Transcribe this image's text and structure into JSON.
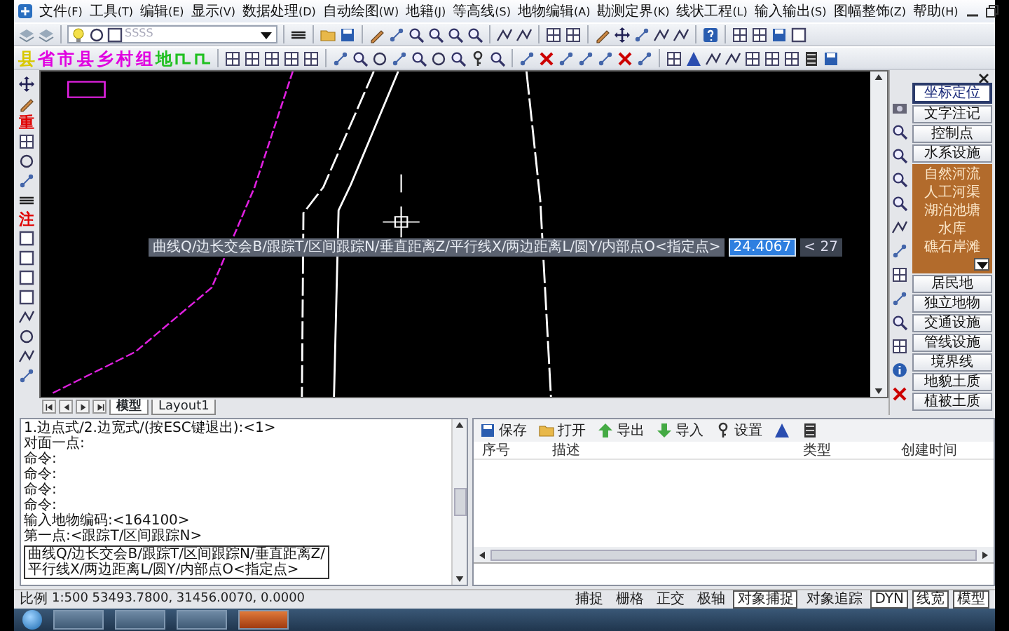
{
  "menu": [
    {
      "label": "文件",
      "key": "(F)"
    },
    {
      "label": "工具",
      "key": "(T)"
    },
    {
      "label": "编辑",
      "key": "(E)"
    },
    {
      "label": "显示",
      "key": "(V)"
    },
    {
      "label": "数据处理",
      "key": "(D)"
    },
    {
      "label": "自动绘图",
      "key": "(W)"
    },
    {
      "label": "地籍",
      "key": "(J)"
    },
    {
      "label": "等高线",
      "key": "(S)"
    },
    {
      "label": "地物编辑",
      "key": "(A)"
    },
    {
      "label": "勘测定界",
      "key": "(K)"
    },
    {
      "label": "线状工程",
      "key": "(L)"
    },
    {
      "label": "输入输出",
      "key": "(S)"
    },
    {
      "label": "图幅整饰",
      "key": "(Z)"
    },
    {
      "label": "帮助",
      "key": "(H)"
    }
  ],
  "layer_dropdown": {
    "value": "SSSS"
  },
  "draw_toolbar": [
    {
      "label": "县",
      "color": "#d8c800"
    },
    {
      "label": "省",
      "color": "#e000e0"
    },
    {
      "label": "市",
      "color": "#e000e0"
    },
    {
      "label": "县",
      "color": "#e000e0"
    },
    {
      "label": "乡",
      "color": "#e000e0"
    },
    {
      "label": "村",
      "color": "#e000e0"
    },
    {
      "label": "组",
      "color": "#e000e0"
    },
    {
      "label": "地",
      "color": "#20c020"
    }
  ],
  "left_toolbar": {
    "labels": [
      "重",
      "注"
    ]
  },
  "canvas_tooltip": {
    "prompt": "曲线Q/边长交会B/跟踪T/区间跟踪N/垂直距离Z/平行线X/两边距离L/圆Y/内部点O<指定点>",
    "value": "24.4067",
    "next": "< 27"
  },
  "layout_tabs": [
    {
      "label": "模型",
      "selected": true
    },
    {
      "label": "Layout1",
      "selected": false
    }
  ],
  "side_panel": [
    {
      "kind": "button",
      "label": "坐标定位",
      "selected": true
    },
    {
      "kind": "button",
      "label": "文字注记",
      "selected": false
    },
    {
      "kind": "button",
      "label": "控制点",
      "selected": false
    },
    {
      "kind": "button",
      "label": "水系设施",
      "selected": false
    },
    {
      "kind": "list",
      "label": "自然河流",
      "selected": false
    },
    {
      "kind": "list",
      "label": "人工河渠",
      "selected": false
    },
    {
      "kind": "list",
      "label": "湖泊池塘",
      "selected": false
    },
    {
      "kind": "list",
      "label": "水库",
      "selected": false
    },
    {
      "kind": "list",
      "label": "礁石岸滩",
      "selected": false
    },
    {
      "kind": "button",
      "label": "居民地",
      "selected": false
    },
    {
      "kind": "button",
      "label": "独立地物",
      "selected": false
    },
    {
      "kind": "button",
      "label": "交通设施",
      "selected": false
    },
    {
      "kind": "button",
      "label": "管线设施",
      "selected": false
    },
    {
      "kind": "button",
      "label": "境界线",
      "selected": false
    },
    {
      "kind": "button",
      "label": "地貌土质",
      "selected": false
    },
    {
      "kind": "button",
      "label": "植被土质",
      "selected": false
    }
  ],
  "command": {
    "lines": [
      "1.边点式/2.边宽式/(按ESC键退出):<1>",
      "对面一点:",
      "命令:",
      "命令:",
      "命令:",
      "命令:",
      "输入地物编码:<164100>",
      "第一点:<跟踪T/区间跟踪N>"
    ],
    "popup": [
      "曲线Q/边长交会B/跟踪T/区间跟踪N/垂直距离Z/",
      "平行线X/两边距离L/圆Y/内部点O<指定点>"
    ]
  },
  "record_panel": {
    "toolbar": [
      "保存",
      "打开",
      "导出",
      "导入",
      "设置"
    ],
    "columns": [
      "序号",
      "描述",
      "类型",
      "创建时间"
    ]
  },
  "status_bar": {
    "scale_label": "比例",
    "coordinates": "1:500  53493.7800, 31456.0070, 0.0000",
    "toggles": [
      {
        "label": "捕捉",
        "on": false
      },
      {
        "label": "栅格",
        "on": false
      },
      {
        "label": "正交",
        "on": false
      },
      {
        "label": "极轴",
        "on": false
      },
      {
        "label": "对象捕捉",
        "on": true
      },
      {
        "label": "对象追踪",
        "on": false
      },
      {
        "label": "DYN",
        "on": true
      },
      {
        "label": "线宽",
        "on": true
      },
      {
        "label": "模型",
        "on": true
      }
    ]
  }
}
